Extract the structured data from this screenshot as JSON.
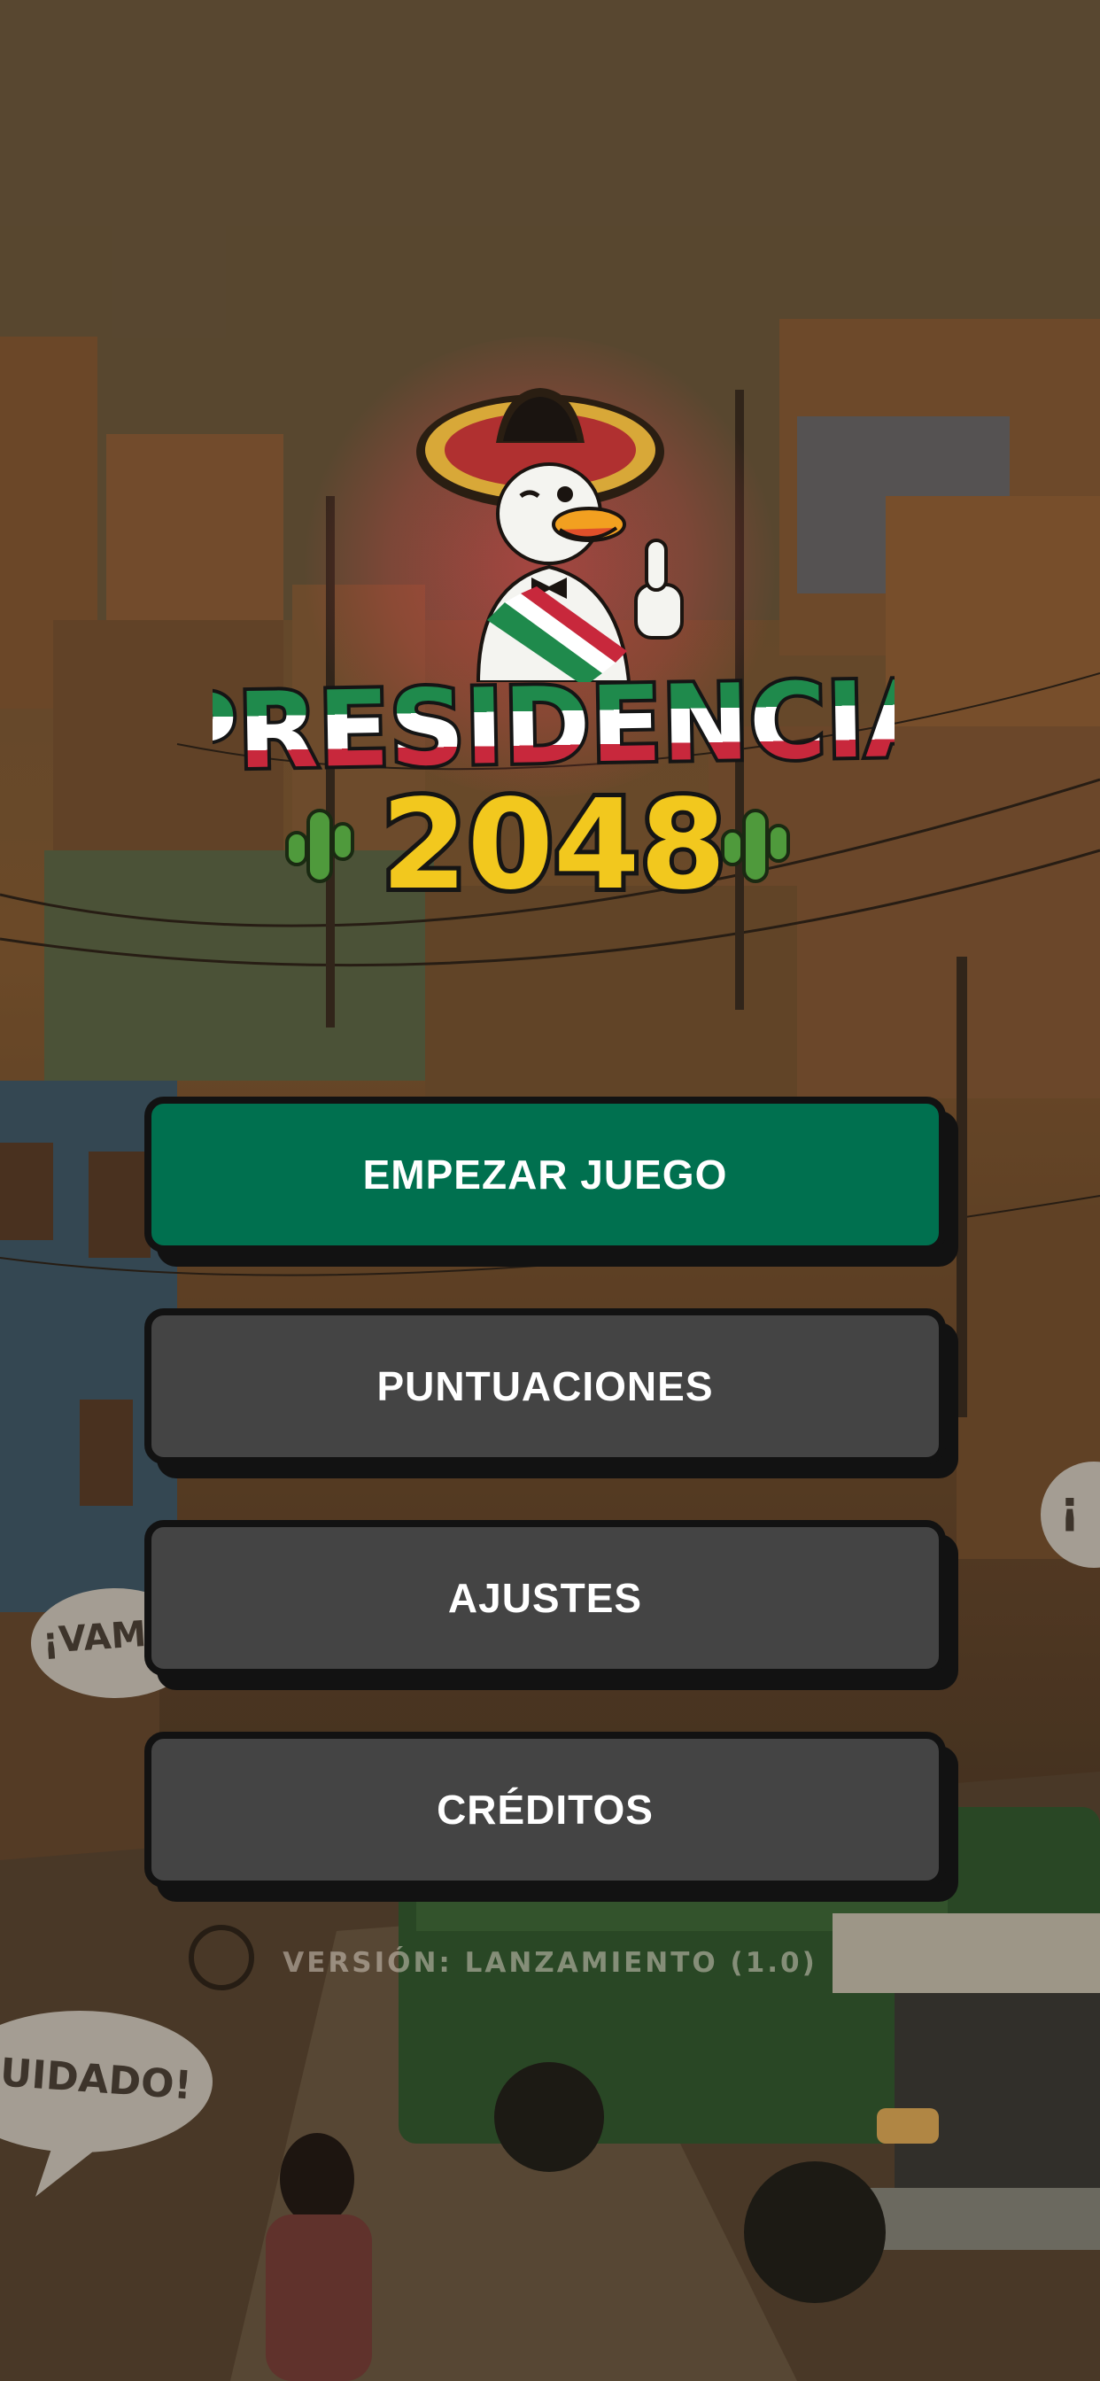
{
  "game": {
    "title_line1": "PRESIDENCIA",
    "title_line2": "2048",
    "version": "VERSIÓN: LANZAMIENTO (1.0)"
  },
  "menu": {
    "buttons": [
      {
        "label": "EMPEZAR JUEGO",
        "style": "primary"
      },
      {
        "label": "PUNTUACIONES",
        "style": "secondary"
      },
      {
        "label": "AJUSTES",
        "style": "secondary"
      },
      {
        "label": "CRÉDITOS",
        "style": "secondary"
      }
    ]
  },
  "background": {
    "bubbles": [
      "¡VAM",
      "UIDADO!",
      "¡"
    ]
  },
  "colors": {
    "primary_button": "#00704f",
    "secondary_button": "#444444",
    "button_border": "#121212",
    "flag_green": "#1f8a4c",
    "flag_white": "#ffffff",
    "flag_red": "#c8283c",
    "title_yellow": "#f2c81e"
  },
  "icons": {
    "mascot": "duck-mascot-icon",
    "cactus": "cactus-icon"
  }
}
